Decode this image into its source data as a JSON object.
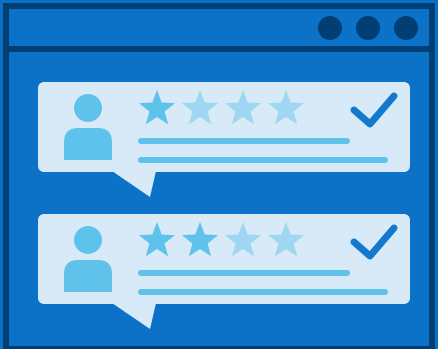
{
  "colors": {
    "frame_fill": "#0c72c8",
    "frame_border": "#003e73",
    "title_bar": "#0a70c6",
    "window_buttons": "#003e73",
    "card": "#d8eaf8",
    "avatar": "#5ec2ea",
    "star_filled": "#5ec2ea",
    "star_empty": "#9fd7f2",
    "text_lines": "#5ec2ea",
    "check": "#1479cc"
  },
  "window": {
    "buttons": [
      "circle-button",
      "circle-button",
      "circle-button"
    ]
  },
  "reviews": [
    {
      "rating": 1,
      "max_rating": 4,
      "approved": true
    },
    {
      "rating": 2,
      "max_rating": 4,
      "approved": true
    }
  ]
}
